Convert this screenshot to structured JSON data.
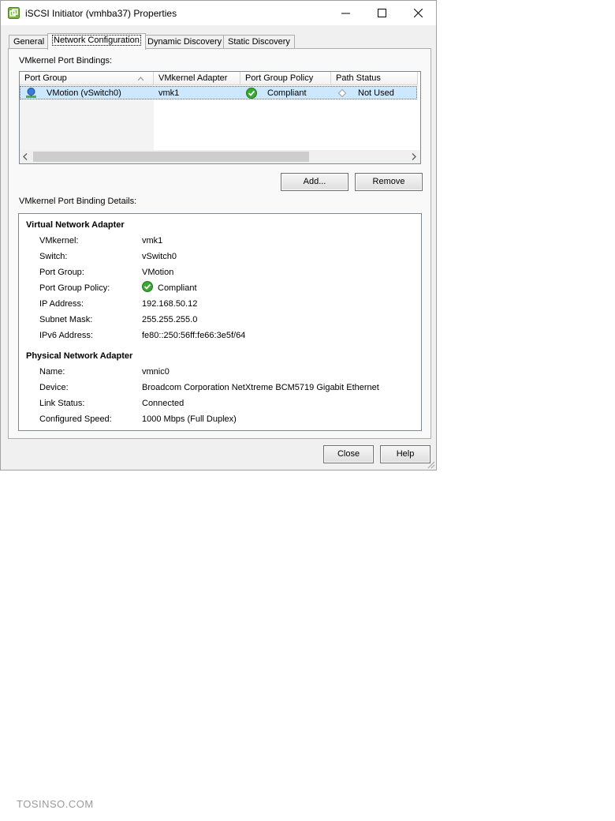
{
  "window": {
    "title": "iSCSI Initiator (vmhba37) Properties"
  },
  "tabs": [
    {
      "label": "General"
    },
    {
      "label": "Network Configuration"
    },
    {
      "label": "Dynamic Discovery"
    },
    {
      "label": "Static Discovery"
    }
  ],
  "bindings": {
    "section_label": "VMkernel Port Bindings:",
    "columns": [
      "Port Group",
      "VMkernel Adapter",
      "Port Group Policy",
      "Path Status"
    ],
    "rows": [
      {
        "port_group": "VMotion (vSwitch0)",
        "adapter": "vmk1",
        "policy": "Compliant",
        "path_status": "Not Used"
      }
    ],
    "add_label": "Add...",
    "remove_label": "Remove"
  },
  "details": {
    "section_label": "VMkernel Port Binding Details:",
    "virtual_title": "Virtual Network Adapter",
    "virtual": [
      {
        "key": "VMkernel:",
        "value": "vmk1"
      },
      {
        "key": "Switch:",
        "value": "vSwitch0"
      },
      {
        "key": "Port Group:",
        "value": "VMotion"
      },
      {
        "key": "Port Group Policy:",
        "value": "Compliant"
      },
      {
        "key": "IP Address:",
        "value": "192.168.50.12"
      },
      {
        "key": "Subnet Mask:",
        "value": "255.255.255.0"
      },
      {
        "key": "IPv6 Address:",
        "value": "fe80::250:56ff:fe66:3e5f/64"
      }
    ],
    "physical_title": "Physical Network Adapter",
    "physical": [
      {
        "key": "Name:",
        "value": "vmnic0"
      },
      {
        "key": "Device:",
        "value": "Broadcom Corporation NetXtreme BCM5719 Gigabit Ethernet"
      },
      {
        "key": "Link Status:",
        "value": "Connected"
      },
      {
        "key": "Configured Speed:",
        "value": "1000 Mbps (Full Duplex)"
      }
    ]
  },
  "footer": {
    "close_label": "Close",
    "help_label": "Help"
  },
  "watermark": "TOSINSO.COM",
  "colors": {
    "selection": "#cce8ff",
    "compliant": "#3aa832"
  }
}
